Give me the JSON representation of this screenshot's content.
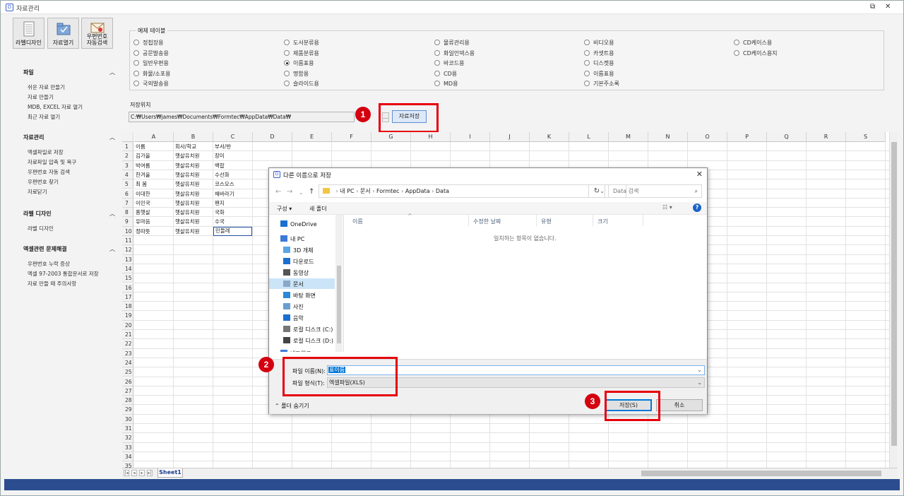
{
  "window": {
    "title": "자료관리"
  },
  "ribbon": [
    {
      "label_line1": "라벨디자인",
      "label_line2": ""
    },
    {
      "label_line1": "자료열기",
      "label_line2": ""
    },
    {
      "label_line1": "우편번호",
      "label_line2": "자동검색"
    }
  ],
  "sidebar": {
    "file": {
      "title": "파일",
      "items": [
        "쉬운 자료 만들기",
        "자료 만들기",
        "MDB, EXCEL 자료 열기",
        "최근 자료 열기"
      ]
    },
    "data": {
      "title": "자료관리",
      "items": [
        "엑셀파일로 저장",
        "자료파일 압축 및 복구",
        "우편번호 자동 검색",
        "우편번호 찾기",
        "자료닫기"
      ]
    },
    "label": {
      "title": "라벨 디자인",
      "items": [
        "라벨 디자인"
      ]
    },
    "excel": {
      "title": "엑셀관련 문제해결",
      "items": [
        "우편번호 누락 증상",
        "엑셀 97-2003 통합문서로 저장",
        "자료 만들 때 주의사항"
      ]
    }
  },
  "sample_tables": {
    "legend": "예제 테이블",
    "columns": [
      [
        "정첩장용",
        "공문발송용",
        "일반우편용",
        "화물/소포용",
        "국외발송용"
      ],
      [
        "도서분류용",
        "제품분류용",
        "이름표용",
        "명함용",
        "슬라이드용"
      ],
      [
        "물류관리용",
        "화일인덱스용",
        "바코드용",
        "CD용",
        "MD용"
      ],
      [
        "비디오용",
        "카셋트용",
        "디스켓용",
        "이름표용",
        "기본주소록"
      ],
      [
        "CD케이스용",
        "CD케이스용지"
      ]
    ],
    "selected": "이름표용"
  },
  "save_location": {
    "label": "저장위치",
    "path": "C:₩Users₩james₩Documents₩Formtec₩AppData₩Data₩",
    "browse": "...",
    "save_button": "자료저장"
  },
  "sheet": {
    "columns": [
      "A",
      "B",
      "C",
      "D",
      "E",
      "F",
      "G",
      "H",
      "I",
      "J",
      "K",
      "L",
      "M",
      "N",
      "O",
      "P",
      "Q",
      "R",
      "S"
    ],
    "rows": [
      [
        "이름",
        "회사/학교",
        "부서/반"
      ],
      [
        "김가을",
        "햇살유치원",
        "장미"
      ],
      [
        "박여름",
        "햇살유치원",
        "백합"
      ],
      [
        "한겨울",
        "햇살유치원",
        "수선화"
      ],
      [
        "최 봄",
        "햇살유치원",
        "코스모스"
      ],
      [
        "이대한",
        "햇살유치원",
        "해바라기"
      ],
      [
        "이민국",
        "햇살유치원",
        "팬지"
      ],
      [
        "홍햇살",
        "햇살유치원",
        "국화"
      ],
      [
        "유마음",
        "햇살유치원",
        "수국"
      ],
      [
        "정따뜻",
        "햇살유치원",
        "민들레"
      ]
    ],
    "row_count": 35,
    "tab": "Sheet1"
  },
  "dialog": {
    "title": "다른 이름으로 저장",
    "address": [
      "내 PC",
      "문서",
      "Formtec",
      "AppData",
      "Data"
    ],
    "search_placeholder": "Data 검색",
    "organize": "구성 ▾",
    "new_folder": "새 폴더",
    "tree": [
      "OneDrive",
      "내 PC",
      "3D 개체",
      "다운로드",
      "동영상",
      "문서",
      "바탕 화면",
      "사진",
      "음악",
      "로컬 디스크 (C:)",
      "로컬 디스크 (D:)",
      "네트워크"
    ],
    "tree_selected": "문서",
    "headers": [
      "이름",
      "수정한 날짜",
      "유형",
      "크기"
    ],
    "empty_text": "일치하는 항목이 없습니다.",
    "filename_label": "파일 이름(N):",
    "filename": "표이름",
    "filetype_label": "파일 형식(T):",
    "filetype": "엑셀파일(XLS)",
    "hide_folders": "폴더 숨기기",
    "save": "저장(S)",
    "cancel": "취소"
  },
  "callouts": [
    "1",
    "2",
    "3"
  ],
  "colors": {
    "highlight": "#e5000d",
    "accent": "#0078d7",
    "statusbar": "#2b4d8f"
  }
}
